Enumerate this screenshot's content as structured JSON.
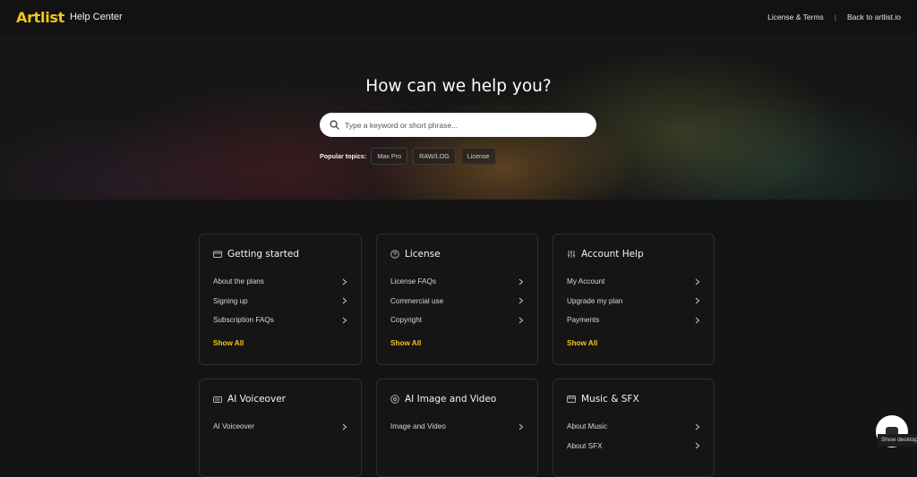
{
  "header": {
    "logo": "Artlist",
    "subtitle": "Help Center",
    "links": [
      "License & Terms",
      "Back to artlist.io"
    ],
    "separator": "|"
  },
  "hero": {
    "title": "How can we help you?",
    "search_placeholder": "Type a keyword or short phrase...",
    "popular_label": "Popular topics:",
    "topics": [
      "Max Pro",
      "RAW/LOG",
      "License"
    ]
  },
  "cards": [
    {
      "title": "Getting started",
      "icon": "card-icon",
      "items": [
        "About the plans",
        "Signing up",
        "Subscription FAQs"
      ],
      "show_all": "Show All"
    },
    {
      "title": "License",
      "icon": "question-circle-icon",
      "items": [
        "License FAQs",
        "Commercial use",
        "Copyright"
      ],
      "show_all": "Show All"
    },
    {
      "title": "Account Help",
      "icon": "sliders-icon",
      "items": [
        "My Account",
        "Upgrade my plan",
        "Payments"
      ],
      "show_all": "Show All"
    },
    {
      "title": "AI Voiceover",
      "icon": "voiceover-icon",
      "items": [
        "AI Voiceover"
      ]
    },
    {
      "title": "AI Image and Video",
      "icon": "image-video-icon",
      "items": [
        "Image and Video"
      ]
    },
    {
      "title": "Music & SFX",
      "icon": "music-icon",
      "items": [
        "About Music",
        "About SFX"
      ]
    }
  ],
  "widget": {
    "label": "Show desktop"
  },
  "colors": {
    "accent": "#f5c518",
    "background": "#141414"
  }
}
